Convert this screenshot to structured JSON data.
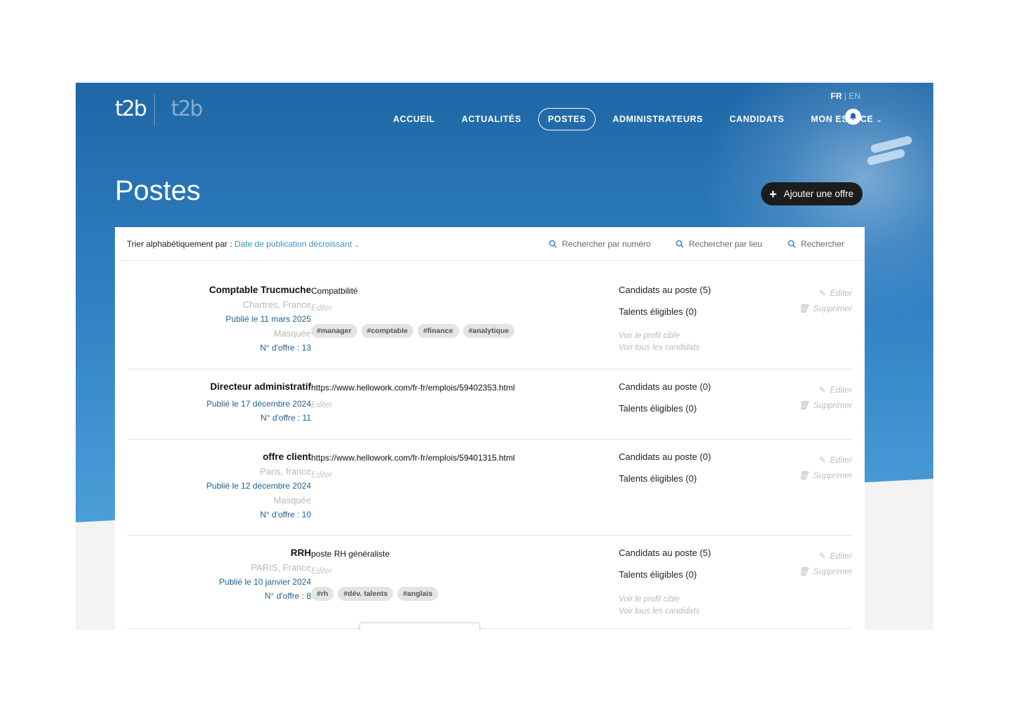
{
  "header": {
    "logo_main": "t2b",
    "logo_secondary": "t2b",
    "lang": {
      "current": "FR",
      "separator": "|",
      "other": "EN"
    },
    "nav": [
      {
        "label": "ACCUEIL",
        "active": false
      },
      {
        "label": "ACTUALITÉS",
        "active": false
      },
      {
        "label": "POSTES",
        "active": true
      },
      {
        "label": "ADMINISTRATEURS",
        "active": false
      },
      {
        "label": "CANDIDATS",
        "active": false
      },
      {
        "label": "MON ESPACE",
        "active": false,
        "dropdown": true
      }
    ],
    "bell_icon": "bell-icon"
  },
  "page": {
    "title": "Postes",
    "add_button_label": "Ajouter une offre"
  },
  "toolbar": {
    "sort_label": "Trier alphabétiquement par :",
    "sort_value": "Date de publication décroissant",
    "search_number": "Rechercher par numéro",
    "search_place": "Rechercher par lieu",
    "search_all": "Rechercher"
  },
  "offers": [
    {
      "title": "Comptable Trucmuche",
      "location": "Chartres, France",
      "published": "Publié le 11 mars 2025",
      "hidden": "Masquée",
      "number": "N° d'offre : 13",
      "description": "Compatbilité",
      "edit_hint": "Editer",
      "tags": [
        "#manager",
        "#comptable",
        "#finance",
        "#analytique"
      ],
      "candidates": "Candidats au poste (5)",
      "talents": "Talents éligibles (0)",
      "profile_link": "Voir le profil cible",
      "all_link": "Voir tous les candidats",
      "edit": "Editer",
      "delete": "Supprimer"
    },
    {
      "title": "Directeur administratif",
      "location": "",
      "published": "Publié le 17 décembre 2024",
      "hidden": "",
      "number": "N° d'offre : 11",
      "description": "https://www.hellowork.com/fr-fr/emplois/59402353.html",
      "edit_hint": "Editer",
      "tags": [],
      "candidates": "Candidats au poste (0)",
      "talents": "Talents éligibles (0)",
      "profile_link": "",
      "all_link": "",
      "edit": "Editer",
      "delete": "Supprimer"
    },
    {
      "title": "offre client",
      "location": "Paris, france",
      "published": "Publié le 12 décembre 2024",
      "hidden": "Masquée",
      "number": "N° d'offre : 10",
      "description": "https://www.hellowork.com/fr-fr/emplois/59401315.html",
      "edit_hint": "Editer",
      "tags": [],
      "candidates": "Candidats au poste (0)",
      "talents": "Talents éligibles (0)",
      "profile_link": "",
      "all_link": "",
      "edit": "Editer",
      "delete": "Supprimer"
    },
    {
      "title": "RRH",
      "location": "PARIS, France",
      "published": "Publié le 10 janvier 2024",
      "hidden": "",
      "number": "N° d'offre : 8",
      "description": "poste RH généraliste",
      "edit_hint": "Editer",
      "tags": [
        "#rh",
        "#dév. talents",
        "#anglais"
      ],
      "candidates": "Candidats au poste (5)",
      "talents": "Talents éligibles (0)",
      "profile_link": "Voir le profil cible",
      "all_link": "Voir tous les candidats",
      "edit": "Editer",
      "delete": "Supprimer"
    }
  ]
}
